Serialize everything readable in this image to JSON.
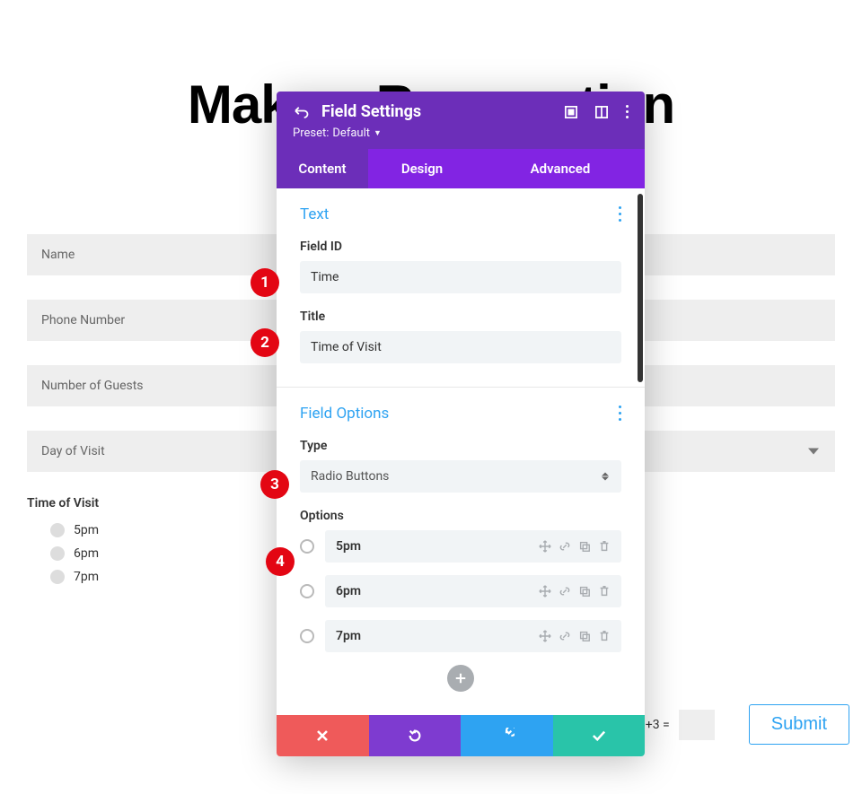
{
  "page": {
    "title": "Make a Reservation"
  },
  "background_form": {
    "fields": {
      "name": "Name",
      "phone": "Phone Number",
      "guests": "Number of Guests",
      "day": "Day of Visit"
    },
    "time_heading": "Time of Visit",
    "time_options": [
      "5pm",
      "6pm",
      "7pm"
    ],
    "captcha": "12 +3 =",
    "submit": "Submit"
  },
  "modal": {
    "title": "Field Settings",
    "preset_label": "Preset:",
    "preset_value": "Default",
    "tabs": {
      "content": "Content",
      "design": "Design",
      "advanced": "Advanced"
    },
    "text_section": {
      "heading": "Text",
      "field_id_label": "Field ID",
      "field_id_value": "Time",
      "title_label": "Title",
      "title_value": "Time of Visit"
    },
    "options_section": {
      "heading": "Field Options",
      "type_label": "Type",
      "type_value": "Radio Buttons",
      "options_label": "Options",
      "options": [
        "5pm",
        "6pm",
        "7pm"
      ]
    }
  },
  "badges": {
    "b1": "1",
    "b2": "2",
    "b3": "3",
    "b4": "4"
  }
}
